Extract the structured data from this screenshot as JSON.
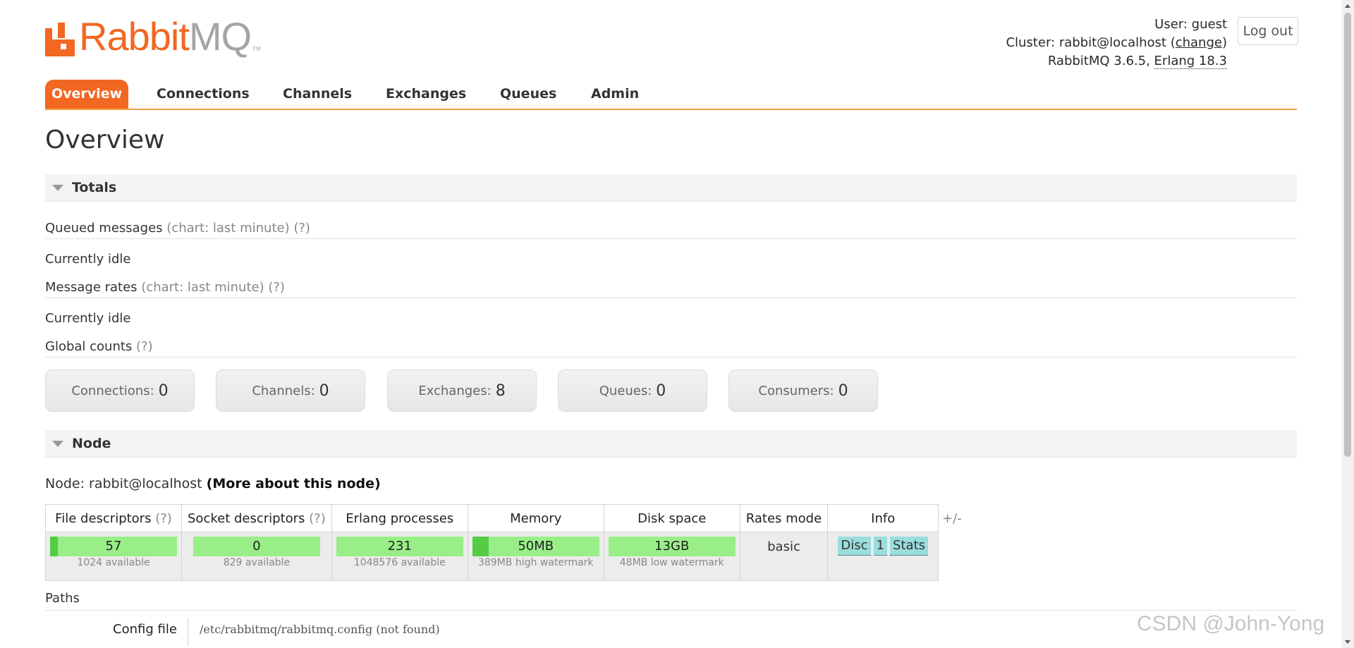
{
  "header": {
    "logo_rabbit": "Rabbit",
    "logo_mq": "MQ",
    "logo_tm": "TM",
    "user_label": "User:",
    "user_name": "guest",
    "cluster_label": "Cluster:",
    "cluster_name": "rabbit@localhost",
    "change_link": "change",
    "version_text": "RabbitMQ 3.6.5,",
    "erlang_text": "Erlang 18.3",
    "logout_label": "Log out"
  },
  "tabs": [
    {
      "label": "Overview"
    },
    {
      "label": "Connections"
    },
    {
      "label": "Channels"
    },
    {
      "label": "Exchanges"
    },
    {
      "label": "Queues"
    },
    {
      "label": "Admin"
    }
  ],
  "page_title": "Overview",
  "totals": {
    "heading": "Totals",
    "queued_label": "Queued messages",
    "queued_chart": "(chart: last minute)",
    "help": "(?)",
    "queued_status": "Currently idle",
    "rates_label": "Message rates",
    "rates_chart": "(chart: last minute)",
    "rates_status": "Currently idle",
    "global_label": "Global counts",
    "counts": [
      {
        "label": "Connections:",
        "value": "0"
      },
      {
        "label": "Channels:",
        "value": "0"
      },
      {
        "label": "Exchanges:",
        "value": "8"
      },
      {
        "label": "Queues:",
        "value": "0"
      },
      {
        "label": "Consumers:",
        "value": "0"
      }
    ]
  },
  "node": {
    "heading": "Node",
    "node_label": "Node: rabbit@localhost",
    "more_link": "(More about this node)",
    "columns": [
      "File descriptors",
      "Socket descriptors",
      "Erlang processes",
      "Memory",
      "Disk space",
      "Rates mode",
      "Info"
    ],
    "file_desc": {
      "value": "57",
      "sub": "1024 available",
      "fill": 0.06
    },
    "socket_desc": {
      "value": "0",
      "sub": "829 available",
      "fill": 0.0
    },
    "erlang_proc": {
      "value": "231",
      "sub": "1048576 available",
      "fill": 0.0
    },
    "memory": {
      "value": "50MB",
      "sub": "389MB high watermark",
      "fill": 0.13
    },
    "disk": {
      "value": "13GB",
      "sub": "48MB low watermark",
      "fill": 0.0
    },
    "rates_mode": "basic",
    "info_badges": [
      "Disc",
      "1",
      "Stats"
    ],
    "plus_minus": "+/-"
  },
  "paths": {
    "label": "Paths",
    "config_label": "Config file",
    "config_value": "/etc/rabbitmq/rabbitmq.config (not found)"
  },
  "watermark": "CSDN @John-Yong"
}
